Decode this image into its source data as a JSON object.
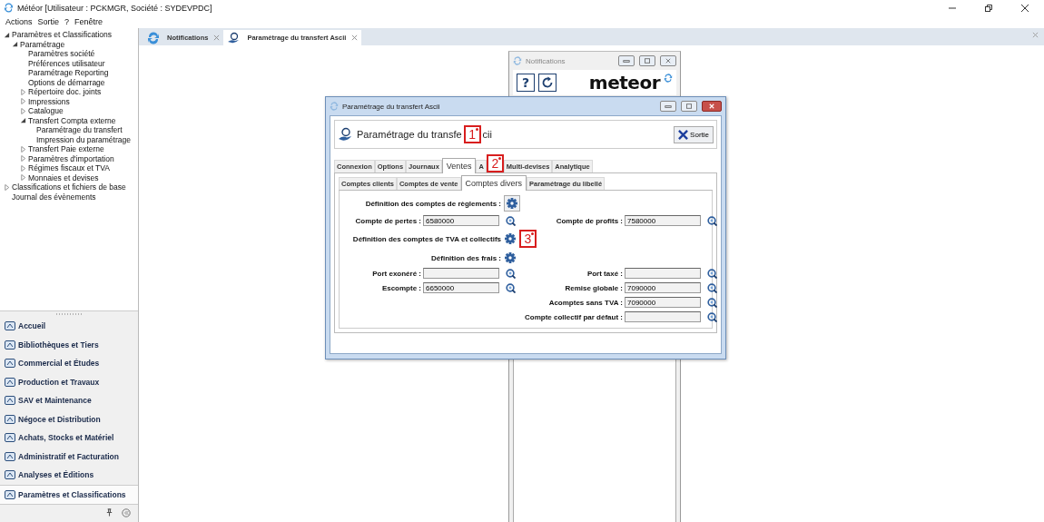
{
  "window": {
    "title": "Météor [Utilisateur : PCKMGR, Société : SYDEVPDC]"
  },
  "menu": [
    "Actions",
    "Sortie",
    "?",
    "Fenêtre"
  ],
  "tree": [
    {
      "label": "Paramètres et Classifications",
      "expanded": true,
      "children": [
        {
          "label": "Paramétrage",
          "expanded": true,
          "children": [
            {
              "label": "Paramètres société"
            },
            {
              "label": "Préférences utilisateur"
            },
            {
              "label": "Paramétrage Reporting"
            },
            {
              "label": "Options de démarrage"
            },
            {
              "label": "Répertoire doc. joints",
              "expanded": false
            },
            {
              "label": "Impressions",
              "expanded": false
            },
            {
              "label": "Catalogue",
              "expanded": false
            },
            {
              "label": "Transfert Compta externe",
              "expanded": true,
              "children": [
                {
                  "label": "Paramétrage du transfert"
                },
                {
                  "label": "Impression du paramétrage"
                }
              ]
            },
            {
              "label": "Transfert Paie externe",
              "expanded": false
            },
            {
              "label": "Paramètres d'importation",
              "expanded": false
            },
            {
              "label": "Régimes fiscaux et TVA",
              "expanded": false
            },
            {
              "label": "Monnaies et devises",
              "expanded": false
            }
          ]
        }
      ]
    },
    {
      "label": "Classifications et fichiers de base",
      "expanded": false
    },
    {
      "label": "Journal des évènements"
    }
  ],
  "modules": [
    {
      "label": "Accueil",
      "selected": false
    },
    {
      "label": "Bibliothèques et Tiers",
      "selected": false
    },
    {
      "label": "Commercial et Études",
      "selected": false
    },
    {
      "label": "Production et Travaux",
      "selected": false
    },
    {
      "label": "SAV et Maintenance",
      "selected": false
    },
    {
      "label": "Négoce et Distribution",
      "selected": false
    },
    {
      "label": "Achats, Stocks et Matériel",
      "selected": false
    },
    {
      "label": "Administratif et Facturation",
      "selected": false
    },
    {
      "label": "Analyses et Éditions",
      "selected": false
    },
    {
      "label": "Paramètres et Classifications",
      "selected": true
    }
  ],
  "doc_tabs": [
    {
      "label": "Notifications",
      "selected": false
    },
    {
      "label": "Paramétrage du transfert Ascii",
      "selected": true
    }
  ],
  "notifications_window": {
    "title": "Notifications",
    "help": "?",
    "logo": "meteor"
  },
  "dialog": {
    "title": "Paramétrage du transfert Ascii",
    "header": {
      "title": "Paramétrage du transfe",
      "callout": "1",
      "title_rest": "cii",
      "exit": "Sortie"
    },
    "tabs": [
      {
        "label": "Connexion",
        "selected": false
      },
      {
        "label": "Options",
        "selected": false
      },
      {
        "label": "Journaux",
        "selected": false
      },
      {
        "label": "Ventes",
        "selected": true
      },
      {
        "label": "A",
        "selected": false,
        "callout": "2"
      },
      {
        "label": "Multi-devises",
        "selected": false
      },
      {
        "label": "Analytique",
        "selected": false
      }
    ],
    "subtabs": [
      {
        "label": "Comptes clients",
        "selected": false
      },
      {
        "label": "Comptes de vente",
        "selected": false
      },
      {
        "label": "Comptes divers",
        "selected": true
      },
      {
        "label": "Paramétrage du libellé",
        "selected": false
      }
    ],
    "rows": [
      {
        "kind": "action",
        "label": "Définition des comptes de règlements :",
        "framed": true
      },
      {
        "kind": "fields",
        "left": {
          "label": "Compte de pertes :",
          "value": "6580000"
        },
        "right": {
          "label": "Compte de profits :",
          "value": "7580000"
        }
      },
      {
        "kind": "action",
        "label": "Définition des comptes de TVA et collectifs",
        "framed": false,
        "callout": "3"
      },
      {
        "kind": "action",
        "label": "Définition des frais :",
        "framed": false
      },
      {
        "kind": "fields",
        "left": {
          "label": "Port exonéré :"
        },
        "right": {
          "label": "Port taxé :"
        }
      },
      {
        "kind": "fields",
        "left": {
          "label": "Escompte :",
          "value": "6650000"
        },
        "right": {
          "label": "Remise globale :",
          "value": "7090000"
        }
      },
      {
        "kind": "fields",
        "right": {
          "label": "Acomptes sans TVA :",
          "value": "7090000"
        }
      },
      {
        "kind": "fields",
        "right": {
          "label": "Compte collectif par défaut :"
        }
      }
    ]
  }
}
